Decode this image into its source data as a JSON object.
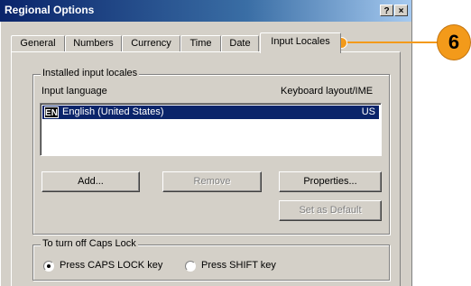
{
  "window": {
    "title": "Regional Options",
    "help_btn": "?",
    "close_btn": "×"
  },
  "tabs": [
    {
      "label": "General"
    },
    {
      "label": "Numbers"
    },
    {
      "label": "Currency"
    },
    {
      "label": "Time"
    },
    {
      "label": "Date"
    },
    {
      "label": "Input Locales"
    }
  ],
  "installed": {
    "group_title": "Installed input locales",
    "col_language": "Input language",
    "col_layout": "Keyboard layout/IME",
    "rows": [
      {
        "badge": "EN",
        "language": "English (United States)",
        "layout": "US"
      }
    ],
    "buttons": {
      "add": "Add...",
      "remove": "Remove",
      "properties": "Properties...",
      "set_default": "Set as Default"
    }
  },
  "caps": {
    "group_title": "To turn off Caps Lock",
    "option_caps": "Press CAPS LOCK key",
    "option_shift": "Press SHIFT key"
  },
  "callout": {
    "number": "6",
    "color": "#f39a1a"
  }
}
